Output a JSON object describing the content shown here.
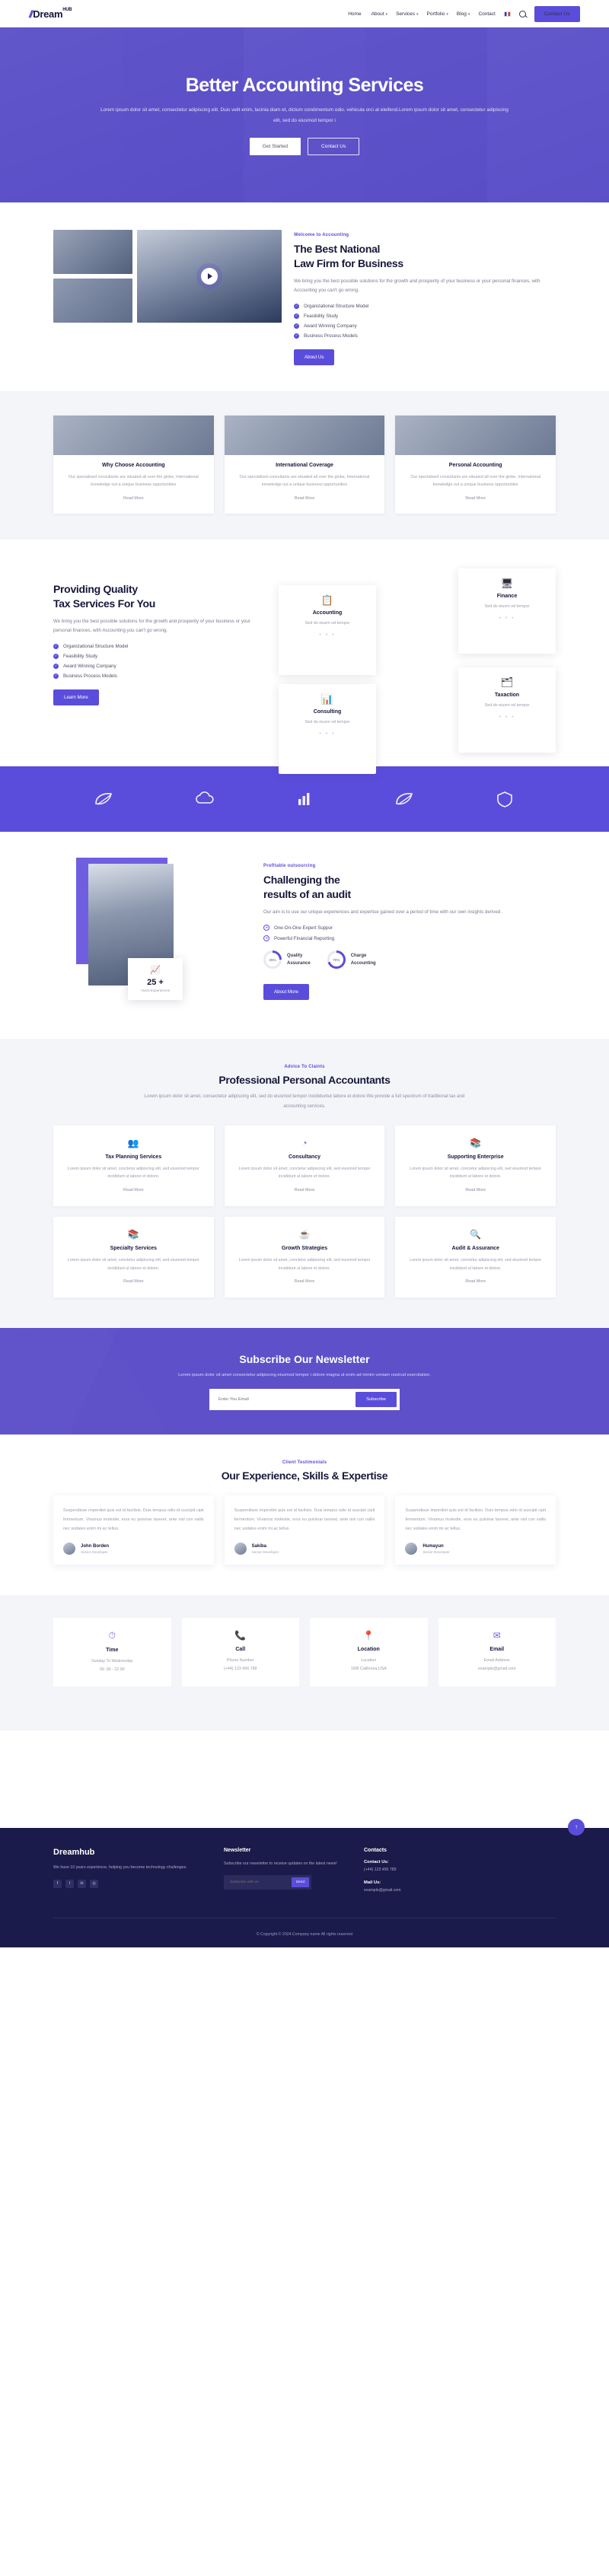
{
  "header": {
    "logo": {
      "slashes": "//",
      "name": "Dream",
      "sup": "HUB"
    },
    "nav": [
      {
        "label": "Home",
        "caret": ""
      },
      {
        "label": "About",
        "caret": "▾"
      },
      {
        "label": "Services",
        "caret": "▾"
      },
      {
        "label": "Portfolio",
        "caret": "▾"
      },
      {
        "label": "Blog",
        "caret": "▾"
      },
      {
        "label": "Contact",
        "caret": ""
      }
    ],
    "language_icon": "flag-icon",
    "search_icon": "search-icon",
    "cta": "Contact Us"
  },
  "hero": {
    "title": "Better Accounting Services",
    "subtitle": "Lorem ipsum dolor sit amet, consectetur adipiscing elit. Duis velit enim, lacinia diam et, dictum condimentum odio. vehicula orci at eleifend.Lorem ipsum dolor sit amet, consectetur adipiscing elit, sed do eiusmod tempor i",
    "btn_primary": "Get Started",
    "btn_secondary": "Contact Us"
  },
  "welcome": {
    "eyebrow": "Welcome to Accounting",
    "title_line1": "The Best National",
    "title_line2": "Law Firm for Business",
    "body": "We bring you the best possible solutions for the growth and prosperity of your business or your personal finances, with Accounting you can't go wrong.",
    "checks": [
      "Organizational Structure Model",
      "Feasibility Study",
      "Award Winning Company",
      "Business Process Models"
    ],
    "button": "About Us",
    "play_icon": "play-icon"
  },
  "features": {
    "cards": [
      {
        "title": "Why Choose Accounting",
        "body": "Our specialised consultants are situated all over the globe, International knowledge out a unique business opportunities",
        "link": "Read More"
      },
      {
        "title": "International Coverage",
        "body": "Our specialised consultants are situated all over the globe, International knowledge out a unique business opportunities",
        "link": "Read More"
      },
      {
        "title": "Personal Accounting",
        "body": "Our specialised consultants are situated all over the globe, International knowledge out a unique business opportunities",
        "link": "Read More"
      }
    ]
  },
  "tax": {
    "title_line1": "Providing Quality",
    "title_line2": "Tax Services For You",
    "body": "We bring you the best possible solutions for the growth and prosperity of your business or your personal finances, with Accounting you can't go wrong.",
    "checks": [
      "Organizational Structure Model",
      "Feasibility Study",
      "Award Winning Company",
      "Business Process Models"
    ],
    "button": "Learn More",
    "cards": [
      {
        "icon": "📋",
        "icon_name": "clipboard-icon",
        "title": "Accounting",
        "body": "Sed do eiusm od tempor",
        "dots": "• • •"
      },
      {
        "icon": "🖥",
        "icon_name": "monitor-chart-icon",
        "title": "Finance",
        "body": "Sed do eiusm od tempor",
        "dots": "• • •"
      },
      {
        "icon": "📊",
        "icon_name": "presentation-icon",
        "title": "Consulting",
        "body": "Sed do eiusm od tempor",
        "dots": "• • •"
      },
      {
        "icon": "🗂",
        "icon_name": "folder-stack-icon",
        "title": "Taxaction",
        "body": "Sed do eiusm od tempor",
        "dots": "• • •"
      }
    ]
  },
  "brands": [
    {
      "name": "brand-leaf-icon",
      "glyph": "❧"
    },
    {
      "name": "brand-cloud-icon",
      "glyph": "☁"
    },
    {
      "name": "brand-bars-icon",
      "glyph": "📶"
    },
    {
      "name": "brand-swirl-icon",
      "glyph": "❧"
    },
    {
      "name": "brand-shield-icon",
      "glyph": "⬡"
    }
  ],
  "audit": {
    "eyebrow": "Profitable outsourcing",
    "title_line1": "Challenging the",
    "title_line2": "results of an audit",
    "body": "Our aim is to use our unique experiences and expertise gained over a period of time with our own insights derived .",
    "bullets": [
      "One-On-One Expert Suppor",
      "Powerful Financial Reporting"
    ],
    "stats": [
      {
        "value": "25%",
        "label_line1": "Quality",
        "label_line2": "Assurance",
        "percent": 25
      },
      {
        "value": "70%",
        "label_line1": "Charge",
        "label_line2": "Accounting",
        "percent": 70
      }
    ],
    "button": "About More",
    "badge": {
      "icon": "📈",
      "icon_name": "growth-chart-icon",
      "number": "25 +",
      "label": "Years Experiences"
    }
  },
  "services": {
    "eyebrow": "Advice To Claints",
    "title": "Professional Personal Accountants",
    "subtitle": "Lorem ipsum dolor sit amet, consectetur adipiscing elit, sed do eiusmod tempor incididuntut labore et dolore We provide a full spectrum of traditional tax and accounting services.",
    "cards": [
      {
        "icon": "👥",
        "icon_name": "people-handshake-icon",
        "title": "Tax Planning Services",
        "body": "Lorem ipsum dolor sit amet, conctetur adipiscing elit, sed eiusmod tempor incididunt ut labore et dolore.",
        "link": "Read More"
      },
      {
        "icon": "◔",
        "icon_name": "pie-chart-icon",
        "title": "Consultancy",
        "body": "Lorem ipsum dolor sit amet, conctetur adipiscing elit, sed eiusmod tempor incididunt ut labore et dolore.",
        "link": "Read More"
      },
      {
        "icon": "📚",
        "icon_name": "books-icon",
        "title": "Supporting Enterprise",
        "body": "Lorem ipsum dolor sit amet, conctetur adipiscing elit, sed eiusmod tempor incididunt ut labore et dolore.",
        "link": "Read More"
      },
      {
        "icon": "📚",
        "icon_name": "ledger-books-icon",
        "title": "Specialty Services",
        "body": "Lorem ipsum dolor sit amet, conctetur adipiscing elit, sed eiusmod tempor incididunt ut labore et dolore.",
        "link": "Read More"
      },
      {
        "icon": "☕",
        "icon_name": "coffee-cup-icon",
        "title": "Growth Strategies",
        "body": "Lorem ipsum dolor sit amet, conctetur adipiscing elit, sed eiusmod tempor incididunt ut labore et dolore.",
        "link": "Read More"
      },
      {
        "icon": "🔍",
        "icon_name": "magnifier-audit-icon",
        "title": "Audit & Assurance",
        "body": "Lorem ipsum dolor sit amet, conctetur adipiscing elit, sed eiusmod tempor incididunt ut labore et dolore.",
        "link": "Read More"
      }
    ]
  },
  "newsletter": {
    "title": "Subscribe Our Newsletter",
    "subtitle": "Lorem ipsum dolor sit amet consectetur adipiscing eiusmod tempor i dolore magna ut enim ad minim veniam nostrud exercitation.",
    "placeholder": "Enter You Email",
    "button": "Subscribe"
  },
  "testimonials": {
    "eyebrow": "Client Testimonials",
    "title": "Our Experience, Skills & Expertise",
    "items": [
      {
        "quote": "Suspendisse imperdiet quis est id facilisis. Duis tempus odio id suscipit cipit fermentum. Vivamus molestie, eros eu pulvinar laoreet, ante nisl con vallis nec sodales enim mi ac tellus.",
        "name": "John Borden",
        "role": "Senior Developer"
      },
      {
        "quote": "Suspendisse imperdiet quis est id facilisis. Duis tempus odio id suscipit cipit fermentum. Vivamus molestie, eros eu pulvinar laoreet, ante nisl con vallis nec sodales enim mi ac tellus.",
        "name": "Sakiba",
        "role": "Senior Developer"
      },
      {
        "quote": "Suspendisse imperdiet quis est id facilisis. Duis tempus odio id suscipit cipit fermentum. Vivamus molestie, eros eu pulvinar laoreet, ante nisl con vallis nec sodales enim mi ac tellus.",
        "name": "Humayun",
        "role": "Senior Developer"
      }
    ]
  },
  "contact_cards": [
    {
      "icon": "⏱",
      "icon_name": "clock-icon",
      "title": "Time",
      "line1": "Sunday To Wednesday",
      "line2": "09 .00 - 22.00"
    },
    {
      "icon": "📞",
      "icon_name": "phone-icon",
      "title": "Call",
      "line1": "Phone Number",
      "line2": "(+44) 123 456 789"
    },
    {
      "icon": "📍",
      "icon_name": "location-pin-icon",
      "title": "Location",
      "line1": "Location",
      "line2": "16/B California,USA"
    },
    {
      "icon": "✉",
      "icon_name": "envelope-icon",
      "title": "Email",
      "line1": "Email Address",
      "line2": "example@gmail.com"
    }
  ],
  "footer": {
    "brand": "Dreamhub",
    "brand_sup": "",
    "about": "We have 10 years experience, helping you become technology challenges.",
    "socials": [
      {
        "name": "facebook-icon",
        "glyph": "f"
      },
      {
        "name": "twitter-icon",
        "glyph": "t"
      },
      {
        "name": "linkedin-icon",
        "glyph": "in"
      },
      {
        "name": "instagram-icon",
        "glyph": "◎"
      }
    ],
    "newsletter_heading": "Newsletter",
    "newsletter_text": "Subscribe our newsletter to receive updates on the latest news!",
    "newsletter_placeholder": "Subscribe with us",
    "newsletter_button": "Send",
    "contacts_heading": "Contacts",
    "contacts": [
      {
        "title": "Contact Us:",
        "value": "(+44) 123 456 789"
      },
      {
        "title": "Mail Us:",
        "value": "example@gmail.com"
      }
    ],
    "copyright": "© Copyright © 2024.Company name All rights reserved",
    "to_top_icon": "arrow-up-icon"
  }
}
